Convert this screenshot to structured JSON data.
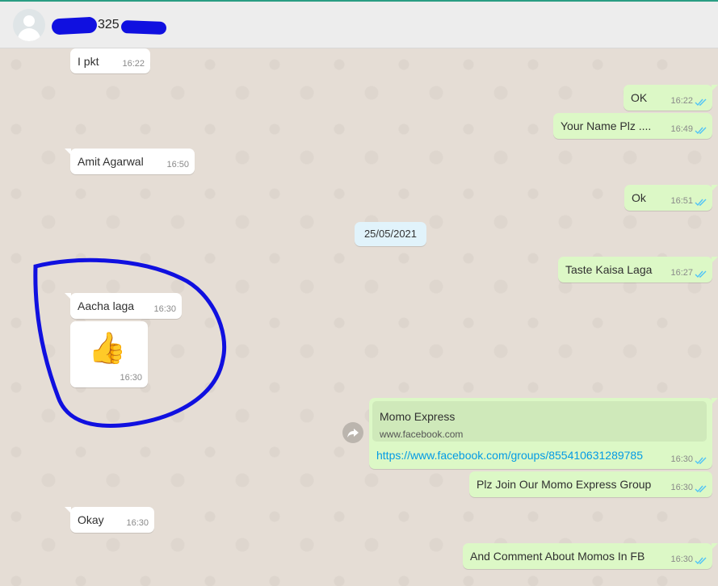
{
  "header": {
    "contact_name": "325"
  },
  "messages": [
    {
      "text": "I pkt",
      "time": "16:22"
    },
    {
      "text": "OK",
      "time": "16:22"
    },
    {
      "text": "Your Name Plz ....",
      "time": "16:49"
    },
    {
      "text": "Amit Agarwal",
      "time": "16:50"
    },
    {
      "text": "Ok",
      "time": "16:51"
    },
    {
      "text": "Taste Kaisa Laga",
      "time": "16:27"
    },
    {
      "text": "Aacha laga",
      "time": "16:30"
    },
    {
      "text": "👍",
      "time": "16:30"
    },
    {
      "text": "https://www.facebook.com/groups/855410631289785",
      "time": "16:30",
      "preview_title": "Momo Express",
      "preview_domain": "www.facebook.com"
    },
    {
      "text": "Plz Join Our Momo Express Group",
      "time": "16:30"
    },
    {
      "text": "Okay",
      "time": "16:30"
    },
    {
      "text": "And Comment About Momos In FB",
      "time": "16:30"
    }
  ],
  "date_separator": "25/05/2021",
  "colors": {
    "incoming_bubble": "#ffffff",
    "outgoing_bubble": "#dcf8c6",
    "read_tick": "#4fc3f7",
    "link": "#039be5",
    "annotation_circle": "#1010e0"
  }
}
